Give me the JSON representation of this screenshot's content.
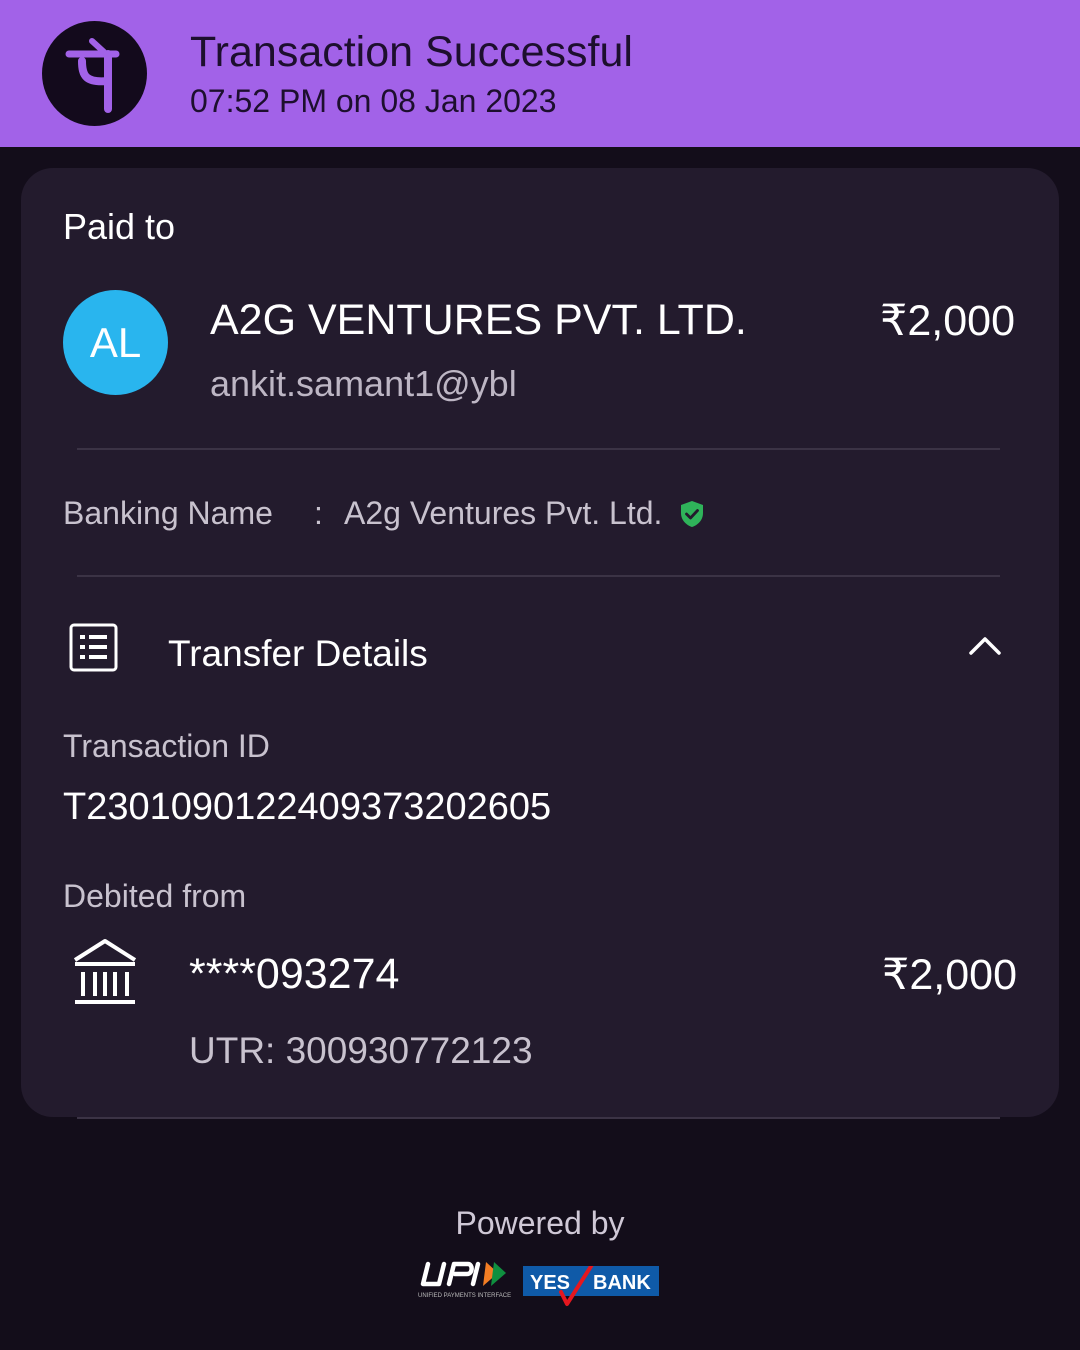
{
  "header": {
    "title": "Transaction Successful",
    "datetime": "07:52 PM on 08 Jan 2023",
    "logo_icon": "phonepe-logo-icon",
    "bg_color": "#a262e8"
  },
  "paid_to": {
    "label": "Paid to",
    "avatar_initials": "AL",
    "avatar_color": "#29b5ee",
    "name": "A2G VENTURES PVT. LTD.",
    "vpa": "ankit.samant1@ybl",
    "amount": "₹2,000"
  },
  "banking_name": {
    "label": "Banking Name",
    "separator": ":",
    "value": "A2g Ventures Pvt. Ltd.",
    "verified_icon": "verified-shield-icon"
  },
  "transfer_details": {
    "title": "Transfer Details",
    "icon": "receipt-list-icon",
    "toggle_icon": "chevron-up-icon",
    "transaction_id_label": "Transaction ID",
    "transaction_id": "T2301090122409373202605",
    "debited_from_label": "Debited from",
    "account": "****093274",
    "amount": "₹2,000",
    "utr": "UTR: 300930772123",
    "bank_icon": "bank-icon"
  },
  "footer": {
    "powered_by": "Powered by",
    "logos": [
      "UPI",
      "YES BANK"
    ]
  }
}
